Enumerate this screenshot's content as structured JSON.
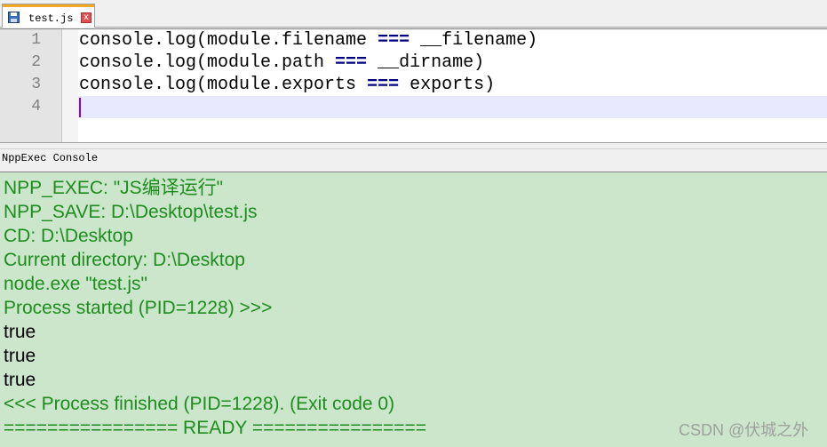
{
  "tab": {
    "label": "test.js",
    "close_glyph": "x",
    "icon": "save-icon"
  },
  "editor": {
    "lines": [
      {
        "number": "1",
        "prefix": "console.log(module.filename ",
        "op": "===",
        "suffix": " __filename)"
      },
      {
        "number": "2",
        "prefix": "console.log(module.path ",
        "op": "===",
        "suffix": " __dirname)"
      },
      {
        "number": "3",
        "prefix": "console.log(module.exports ",
        "op": "===",
        "suffix": " exports)"
      },
      {
        "number": "4",
        "prefix": "",
        "op": "",
        "suffix": ""
      }
    ]
  },
  "console": {
    "title": "NppExec Console",
    "lines": [
      "NPP_EXEC: \"JS编译运行\"",
      "NPP_SAVE: D:\\Desktop\\test.js",
      "CD: D:\\Desktop",
      "Current directory: D:\\Desktop",
      "node.exe \"test.js\"",
      "Process started (PID=1228) >>>",
      "true",
      "true",
      "true",
      "<<< Process finished (PID=1228). (Exit code 0)",
      "================ READY ================"
    ]
  },
  "watermark": "CSDN @伏城之外",
  "colors": {
    "console_bg": "#cbe6cb",
    "console_text": "#1e8c1e",
    "output_text": "#000000",
    "operator": "#000080",
    "current_line": "#e8e8ff",
    "caret": "#8000ff"
  }
}
